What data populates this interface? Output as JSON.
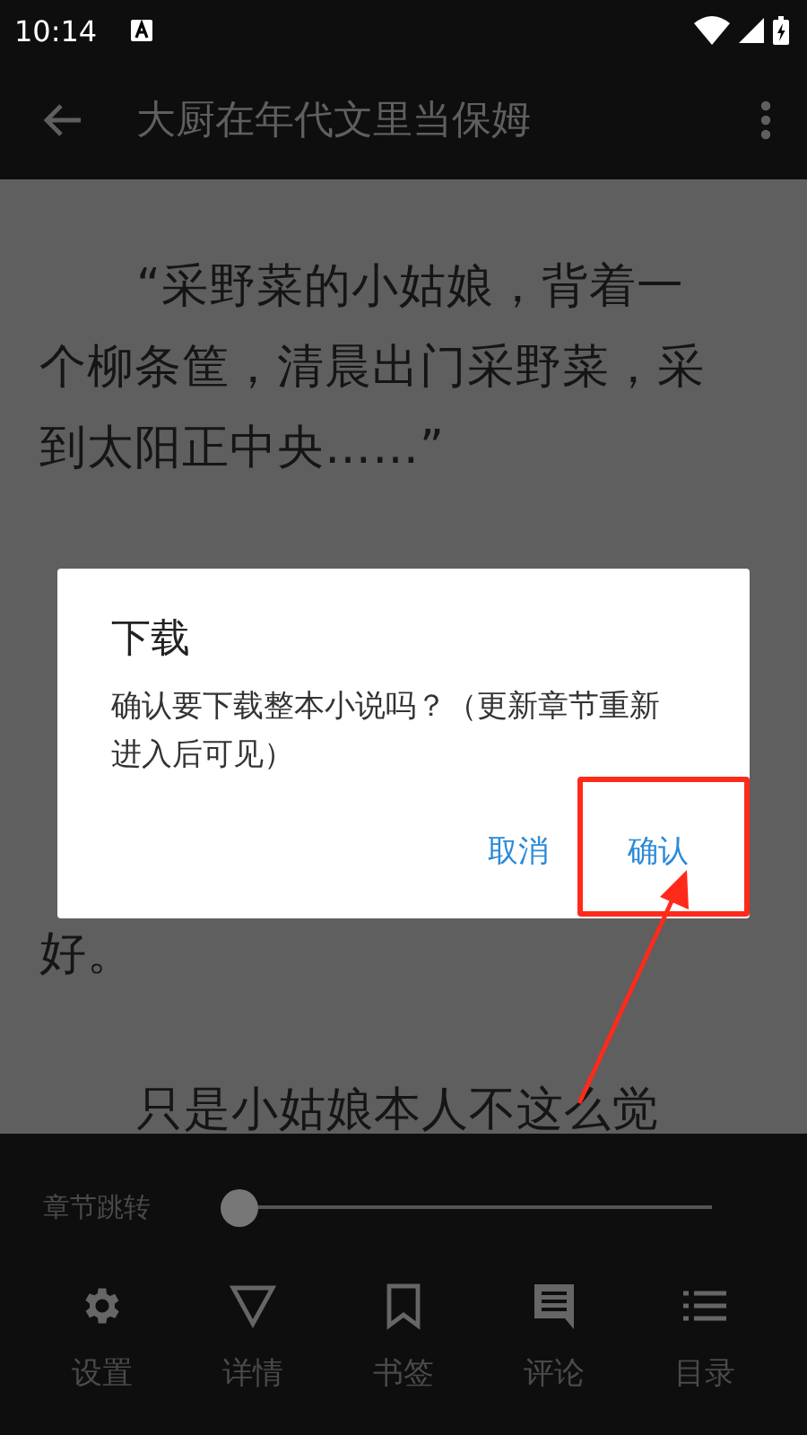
{
  "status_bar": {
    "time": "10:14"
  },
  "app_bar": {
    "title": "大厨在年代文里当保姆"
  },
  "content": {
    "paragraphs": [
      {
        "lines": [
          "“采野菜的小姑娘，背着一",
          "个柳条筐，清晨出门采野菜，采",
          "到太阳正中央……”"
        ],
        "indent": true
      },
      {
        "lines": [
          "好。"
        ],
        "indent": false
      },
      {
        "lines": [
          "只是小姑娘本人不这么觉"
        ],
        "indent": true
      }
    ]
  },
  "dialog": {
    "title": "下载",
    "message": "确认要下载整本小说吗？（更新章节重新进入后可见）",
    "buttons": [
      {
        "label": "取消",
        "highlighted": false
      },
      {
        "label": "确认",
        "highlighted": true
      }
    ]
  },
  "bottom_panel": {
    "slider": {
      "label": "章节跳转",
      "level": 0
    },
    "nav": [
      {
        "kind": "settings",
        "label": "设置"
      },
      {
        "kind": "details",
        "label": "详情"
      },
      {
        "kind": "bookmark",
        "label": "书签"
      },
      {
        "kind": "comments",
        "label": "评论"
      },
      {
        "kind": "contents",
        "label": "目录"
      }
    ]
  }
}
